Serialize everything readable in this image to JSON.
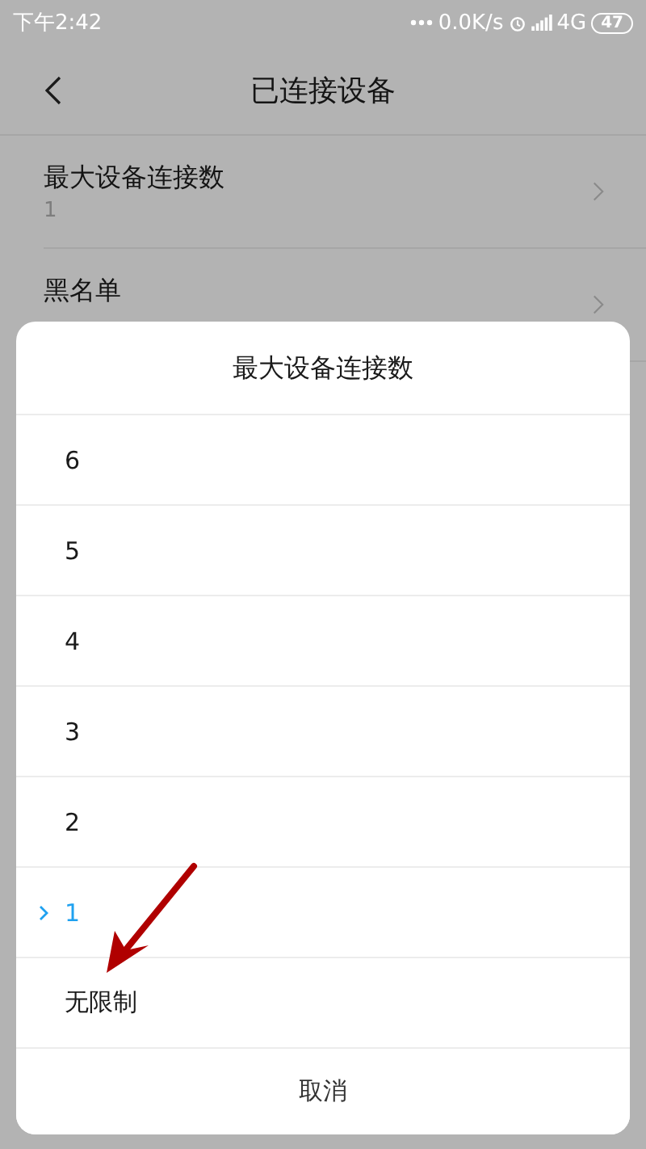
{
  "status_bar": {
    "time": "下午2:42",
    "speed": "0.0K/s",
    "network": "4G",
    "battery": "47"
  },
  "header": {
    "title": "已连接设备"
  },
  "settings": [
    {
      "title": "最大设备连接数",
      "subtitle": "1"
    },
    {
      "title": "黑名单"
    }
  ],
  "dialog": {
    "title": "最大设备连接数",
    "options": [
      {
        "label": "6",
        "selected": false
      },
      {
        "label": "5",
        "selected": false
      },
      {
        "label": "4",
        "selected": false
      },
      {
        "label": "3",
        "selected": false
      },
      {
        "label": "2",
        "selected": false
      },
      {
        "label": "1",
        "selected": true
      },
      {
        "label": "无限制",
        "selected": false
      }
    ],
    "cancel": "取消"
  }
}
